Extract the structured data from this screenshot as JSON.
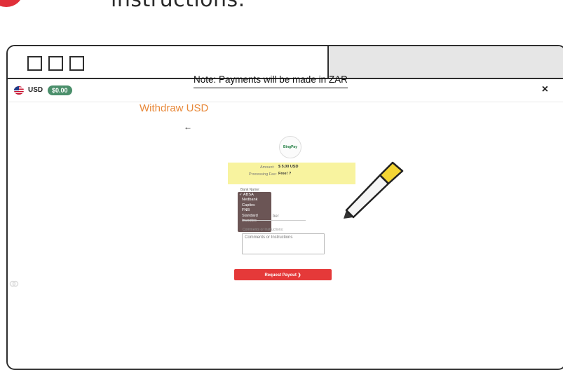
{
  "caption": {
    "text": "instructions."
  },
  "header": {
    "currency": "USD",
    "balance": "$0.00",
    "close": "×"
  },
  "main": {
    "note": "Note: Payments will be made in ZAR",
    "title": "Withdraw USD",
    "back_arrow": "←",
    "logo_text": "BingPay",
    "amount_label": "Amount:",
    "amount_value": "$ 5.00 USD",
    "fee_label": "Processing Fee:",
    "fee_value": "Free! ?",
    "bank_label": "Bank Name:",
    "bank_options": [
      "✓ ABSA",
      "Nedbank",
      "Capitec",
      "FNB",
      "Standard",
      "Investec"
    ],
    "account_fragment": "ber",
    "comments_label": "Comments or Instructions:",
    "comments_placeholder": "Comments or Instructions",
    "request_button": "Request Payout ❯"
  },
  "icons": [
    "close-icon",
    "back-arrow-icon",
    "link-icon",
    "marker-pen-icon",
    "us-flag-icon"
  ],
  "colors": {
    "accent_orange": "#e8893a",
    "balance_green": "#4b8f6b",
    "button_red": "#e53939",
    "highlight_yellow": "#f8f29a"
  }
}
